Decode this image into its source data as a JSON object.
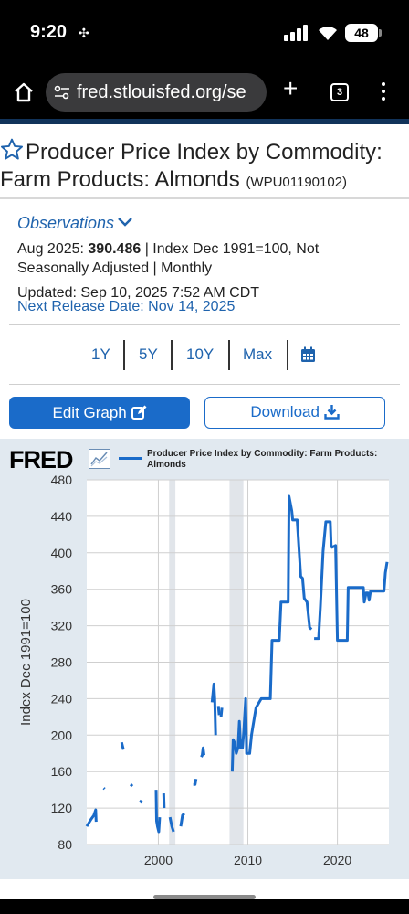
{
  "status_bar": {
    "time": "9:20",
    "battery": "48"
  },
  "browser": {
    "url": "fred.stlouisfed.org/se",
    "tab_count": "3"
  },
  "page": {
    "title": "Producer Price Index by Commodity: Farm Products: Almonds",
    "series_id": "(WPU01190102)",
    "observations_label": "Observations",
    "obs_date": "Aug 2025:",
    "obs_value": "390.486",
    "obs_units": " | Index Dec 1991=100, Not",
    "obs_units_2": "Seasonally Adjusted | Monthly",
    "updated": "Updated: Sep 10, 2025 7:52 AM CDT",
    "next_release": "Next Release Date: Nov 14, 2025",
    "ranges": [
      "1Y",
      "5Y",
      "10Y",
      "Max"
    ],
    "edit_graph": "Edit Graph",
    "download": "Download"
  },
  "chart_data": {
    "type": "line",
    "logo": "FRED",
    "legend": "Producer Price Index by Commodity: Farm Products: Almonds",
    "ylabel": "Index Dec 1991=100",
    "ylim": [
      80,
      480
    ],
    "yticks": [
      80,
      120,
      160,
      200,
      240,
      280,
      320,
      360,
      400,
      440,
      480
    ],
    "xlim": [
      1992.0,
      2025.75
    ],
    "xticks": [
      2000,
      2010,
      2020
    ],
    "xtick_labels": [
      "2000",
      "2010",
      "2020"
    ],
    "recessions": [
      [
        2001.2,
        2001.9
      ],
      [
        2007.95,
        2009.5
      ]
    ],
    "line_color": "#1a6bc9",
    "segments": [
      [
        [
          1992.0,
          100
        ],
        [
          1992.5,
          108
        ],
        [
          1992.8,
          112
        ],
        [
          1993.0,
          118
        ],
        [
          1993.05,
          105
        ]
      ],
      [
        [
          1993.9,
          142
        ],
        [
          1994.0,
          141
        ]
      ],
      [
        [
          1995.9,
          192
        ],
        [
          1996.1,
          184
        ]
      ],
      [
        [
          1996.9,
          146
        ],
        [
          1997.1,
          144
        ]
      ],
      [
        [
          1997.9,
          128
        ],
        [
          1998.2,
          126
        ]
      ],
      [
        [
          1999.75,
          140
        ],
        [
          1999.8,
          106
        ],
        [
          1999.9,
          100
        ],
        [
          2000.05,
          94
        ],
        [
          2000.15,
          110
        ]
      ],
      [
        [
          2000.6,
          136
        ],
        [
          2000.65,
          120
        ]
      ],
      [
        [
          2001.3,
          110
        ],
        [
          2001.5,
          100
        ],
        [
          2001.7,
          94
        ]
      ],
      [
        [
          2002.5,
          100
        ],
        [
          2002.7,
          112
        ],
        [
          2002.9,
          114
        ]
      ],
      [
        [
          2003.9,
          146
        ],
        [
          2004.1,
          146
        ],
        [
          2004.2,
          152
        ]
      ],
      [
        [
          2004.8,
          176
        ],
        [
          2004.9,
          178
        ],
        [
          2005.0,
          186
        ],
        [
          2005.1,
          178
        ]
      ],
      [
        [
          2006.0,
          236
        ],
        [
          2006.2,
          256
        ],
        [
          2006.3,
          240
        ],
        [
          2006.4,
          200
        ]
      ],
      [
        [
          2006.7,
          232
        ],
        [
          2006.8,
          222
        ]
      ],
      [
        [
          2007.0,
          220
        ],
        [
          2007.1,
          230
        ]
      ],
      [
        [
          2008.25,
          160
        ],
        [
          2008.35,
          195
        ],
        [
          2008.5,
          192
        ],
        [
          2008.7,
          180
        ],
        [
          2008.9,
          186
        ],
        [
          2009.05,
          215
        ],
        [
          2009.2,
          186
        ],
        [
          2009.4,
          186
        ],
        [
          2009.55,
          205
        ],
        [
          2009.75,
          240
        ],
        [
          2009.85,
          180
        ],
        [
          2010.2,
          180
        ],
        [
          2010.4,
          200
        ],
        [
          2010.9,
          230
        ],
        [
          2011.5,
          240
        ],
        [
          2012.5,
          240
        ],
        [
          2012.7,
          304
        ],
        [
          2013.5,
          304
        ],
        [
          2013.7,
          346
        ],
        [
          2014.5,
          346
        ],
        [
          2014.6,
          462
        ],
        [
          2014.9,
          446
        ],
        [
          2015.0,
          436
        ],
        [
          2015.5,
          436
        ],
        [
          2015.9,
          374
        ],
        [
          2016.1,
          372
        ],
        [
          2016.3,
          350
        ],
        [
          2016.6,
          346
        ],
        [
          2016.9,
          318
        ],
        [
          2017.1,
          316
        ]
      ],
      [
        [
          2017.4,
          306
        ],
        [
          2017.9,
          306
        ],
        [
          2018.1,
          342
        ],
        [
          2018.4,
          402
        ],
        [
          2018.7,
          434
        ],
        [
          2019.2,
          434
        ],
        [
          2019.3,
          408
        ],
        [
          2019.4,
          406
        ],
        [
          2019.8,
          408
        ],
        [
          2020.0,
          304
        ],
        [
          2021.1,
          304
        ],
        [
          2021.2,
          362
        ],
        [
          2022.9,
          362
        ],
        [
          2023.0,
          346
        ],
        [
          2023.2,
          356
        ],
        [
          2023.4,
          356
        ],
        [
          2023.55,
          348
        ],
        [
          2023.7,
          358
        ],
        [
          2025.2,
          358
        ],
        [
          2025.35,
          378
        ],
        [
          2025.55,
          390
        ]
      ]
    ]
  }
}
